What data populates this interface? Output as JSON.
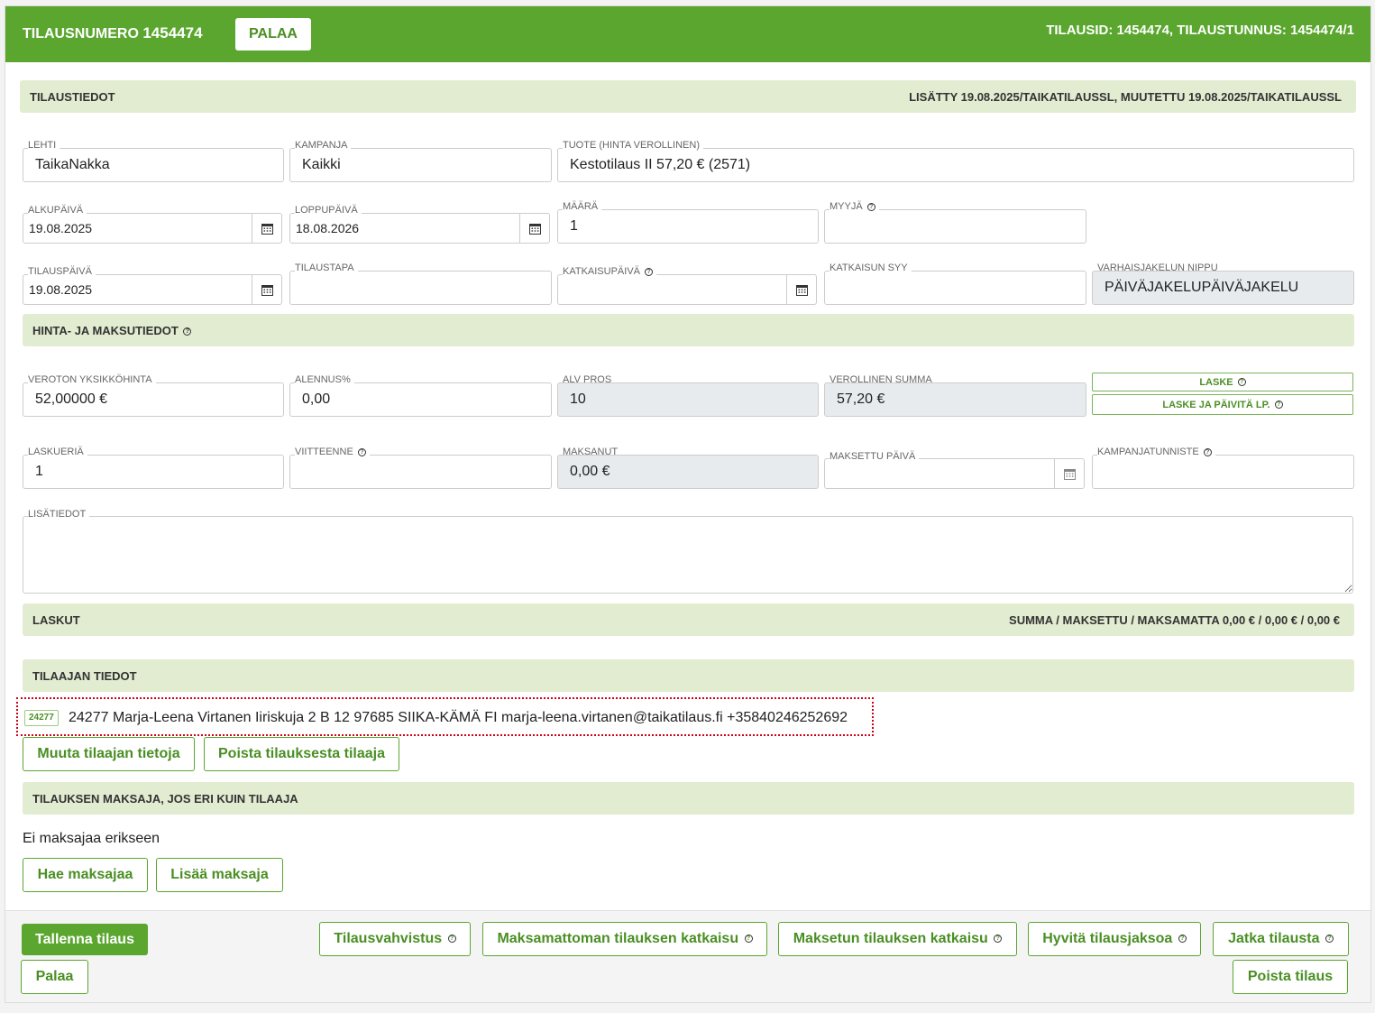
{
  "header": {
    "title_prefix": "TILAUSNUMERO",
    "order_number": "1454474",
    "back_button": "PALAA",
    "ids": "TILAUSID: 1454474, TILAUSTUNNUS: 1454474/1"
  },
  "tilaustiedot": {
    "title": "TILAUSTIEDOT",
    "meta": "LISÄTTY 19.08.2025/TAIKATILAUSSL, MUUTETTU 19.08.2025/TAIKATILAUSSL"
  },
  "fields": {
    "lehti": {
      "label": "LEHTI",
      "value": "TaikaNakka"
    },
    "kampanja": {
      "label": "KAMPANJA",
      "value": "Kaikki"
    },
    "tuote": {
      "label": "TUOTE (HINTA VEROLLINEN)",
      "value": "Kestotilaus II 57,20 € (2571)"
    },
    "alkupaiva": {
      "label": "ALKUPÄIVÄ",
      "value": "19.08.2025"
    },
    "loppupaiva": {
      "label": "LOPPUPÄIVÄ",
      "value": "18.08.2026"
    },
    "maara": {
      "label": "MÄÄRÄ",
      "value": "1"
    },
    "myyja": {
      "label": "MYYJÄ",
      "value": ""
    },
    "tilauspaiva": {
      "label": "TILAUSPÄIVÄ",
      "value": "19.08.2025"
    },
    "tilaustapa": {
      "label": "TILAUSTAPA",
      "value": ""
    },
    "katkaisupaiva": {
      "label": "KATKAISUPÄIVÄ",
      "value": ""
    },
    "katkaisun_syy": {
      "label": "KATKAISUN SYY",
      "value": ""
    },
    "varhaisjakelun_nippu": {
      "label": "VARHAISJAKELUN NIPPU",
      "value": "PÄIVÄJAKELUPÄIVÄJAKELU"
    },
    "veroton": {
      "label": "VEROTON YKSIKKÖHINTA",
      "value": "52,00000 €"
    },
    "alennus": {
      "label": "ALENNUS%",
      "value": "0,00"
    },
    "alv": {
      "label": "ALV PROS",
      "value": "10"
    },
    "verollinen": {
      "label": "VEROLLINEN SUMMA",
      "value": "57,20 €"
    },
    "laskueria": {
      "label": "LASKUERIÄ",
      "value": "1"
    },
    "viitteenne": {
      "label": "VIITTEENNE",
      "value": ""
    },
    "maksanut": {
      "label": "MAKSANUT",
      "value": "0,00 €"
    },
    "maksettu_paiva": {
      "label": "MAKSETTU PÄIVÄ",
      "value": ""
    },
    "kampanjatunniste": {
      "label": "KAMPANJATUNNISTE",
      "value": ""
    },
    "lisatiedot": {
      "label": "LISÄTIEDOT",
      "value": ""
    }
  },
  "hinta": {
    "title": "HINTA- JA MAKSUTIEDOT",
    "laske": "LASKE",
    "laske_paivita": "LASKE JA PÄIVITÄ LP."
  },
  "laskut": {
    "title": "LASKUT",
    "summary": "SUMMA / MAKSETTU / MAKSAMATTA 0,00 € / 0,00 € / 0,00 €"
  },
  "tilaaja": {
    "title": "TILAAJAN TIEDOT",
    "badge": "24277",
    "line": "24277 Marja-Leena Virtanen Iiriskuja 2 B 12 97685 SIIKA-KÄMÄ FI marja-leena.virtanen@taikatilaus.fi +35840246252692",
    "edit_button": "Muuta tilaajan tietoja",
    "remove_button": "Poista tilauksesta tilaaja"
  },
  "maksaja": {
    "title": "TILAUKSEN MAKSAJA, JOS ERI KUIN TILAAJA",
    "none_text": "Ei maksajaa erikseen",
    "fetch_button": "Hae maksajaa",
    "add_button": "Lisää maksaja"
  },
  "footer": {
    "save": "Tallenna tilaus",
    "back": "Palaa",
    "confirm": "Tilausvahvistus",
    "unpaid_cut": "Maksamattoman tilauksen katkaisu",
    "paid_cut": "Maksetun tilauksen katkaisu",
    "credit": "Hyvitä tilausjaksoa",
    "continue": "Jatka tilausta",
    "delete": "Poista tilaus"
  },
  "colors": {
    "brand": "#5aa62e",
    "section_bg": "#e2ecd1",
    "readonly_bg": "#e8ebee"
  }
}
